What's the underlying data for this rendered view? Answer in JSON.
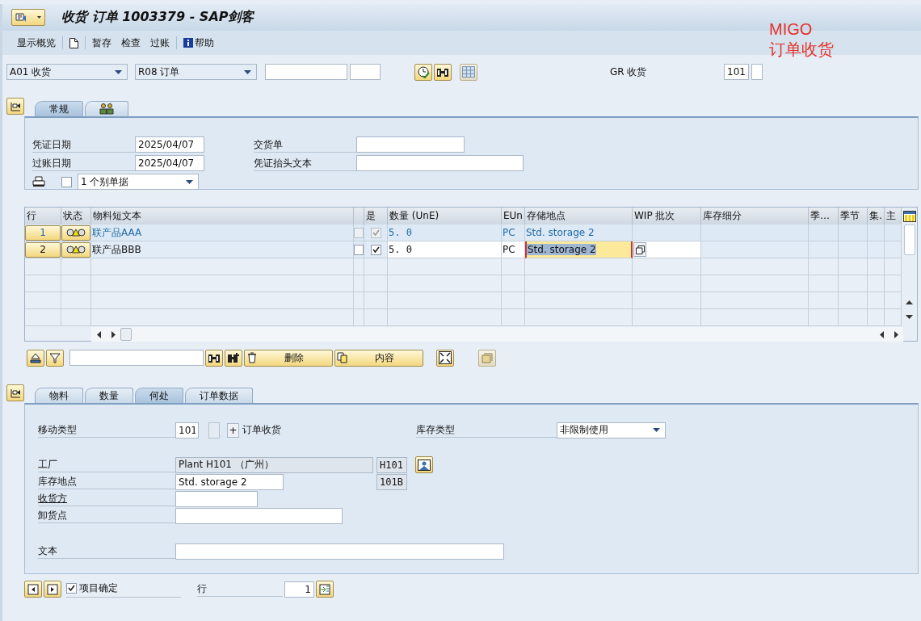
{
  "window": {
    "title": "收货 订单 1003379 - SAP剑客"
  },
  "annotation": {
    "lines": [
      "MIGO",
      "订单收货"
    ]
  },
  "toolbar": [
    {
      "kind": "text",
      "label": "显示概览",
      "separator_after": true
    },
    {
      "kind": "new-document",
      "separator_after": true
    },
    {
      "kind": "text",
      "label": "暂存",
      "separator_after": false
    },
    {
      "kind": "text",
      "label": "检查",
      "separator_after": false
    },
    {
      "kind": "text",
      "label": "过账",
      "separator_after": true
    },
    {
      "kind": "help",
      "label": "帮助",
      "separator_after": false
    }
  ],
  "action_bar": {
    "transaction": "A01 收货",
    "reference": "R08 订单",
    "gr_label": "GR 收货",
    "movement_type": "101"
  },
  "header": {
    "tabs": [
      {
        "kind": "text",
        "label": "常规",
        "selected": true
      },
      {
        "kind": "partners",
        "selected": false
      }
    ],
    "document_date": {
      "label": "凭证日期",
      "value": "2025/04/07"
    },
    "posting_date": {
      "label": "过账日期",
      "value": "2025/04/07"
    },
    "delivery_note": {
      "label": "交货单"
    },
    "header_text": {
      "label": "凭证抬头文本"
    },
    "print": {
      "checked": false,
      "option": "1 个别单据"
    }
  },
  "items": {
    "columns": [
      {
        "label": "行"
      },
      {
        "label": "状态"
      },
      {
        "label": "物料短文本"
      },
      {},
      {
        "label": "是"
      },
      {
        "label": "数量 (UnE)"
      },
      {
        "label": "EUn"
      },
      {
        "label": "存储地点"
      },
      {
        "label": "WIP 批次"
      },
      {
        "label": "库存细分"
      },
      {
        "label": "季…"
      },
      {
        "label": "季节"
      },
      {
        "label": "集."
      },
      {
        "label": "主"
      }
    ],
    "rows": [
      {
        "line": "1",
        "status": {
          "kind": "warning"
        },
        "text": "联产品AAA",
        "column_4_checked": false,
        "ok_checked": true,
        "quantity": "5. 0",
        "unit": "PC",
        "storage_location": "Std. storage 2",
        "editable": false,
        "storage_focused": false
      },
      {
        "line": "2",
        "status": {
          "kind": "warning"
        },
        "text": "联产品BBB",
        "column_4_checked": false,
        "ok_checked": true,
        "quantity": "5. 0",
        "unit": "PC",
        "storage_location": "Std. storage 2",
        "editable": true,
        "storage_focused": true
      }
    ]
  },
  "item_toolbar": {
    "buttons": [
      {
        "kind": "delete",
        "label": "删除"
      },
      {
        "kind": "contents",
        "label": "内容"
      }
    ]
  },
  "detail": {
    "tabs": [
      {
        "label": "物料",
        "selected": false
      },
      {
        "label": "数量",
        "selected": false
      },
      {
        "label": "何处",
        "selected": true
      },
      {
        "label": "订单数据",
        "selected": false
      }
    ],
    "movement_type": {
      "label": "移动类型",
      "code": "101",
      "button": "+",
      "text": "订单收货"
    },
    "stock_type": {
      "label": "库存类型",
      "value": "非限制使用"
    },
    "plant": {
      "label": "工厂",
      "value": "Plant H101 （广州）",
      "code": "H101"
    },
    "storage_location": {
      "label": "库存地点",
      "value": "Std. storage 2",
      "code": "101B"
    },
    "recipient": {
      "label": "收货方"
    },
    "unloading_point": {
      "label": "卸货点"
    },
    "text": {
      "label": "文本"
    }
  },
  "footer": {
    "item_ok": {
      "label": "项目确定",
      "checked": true
    },
    "line": {
      "label": "行",
      "value": "1"
    }
  }
}
